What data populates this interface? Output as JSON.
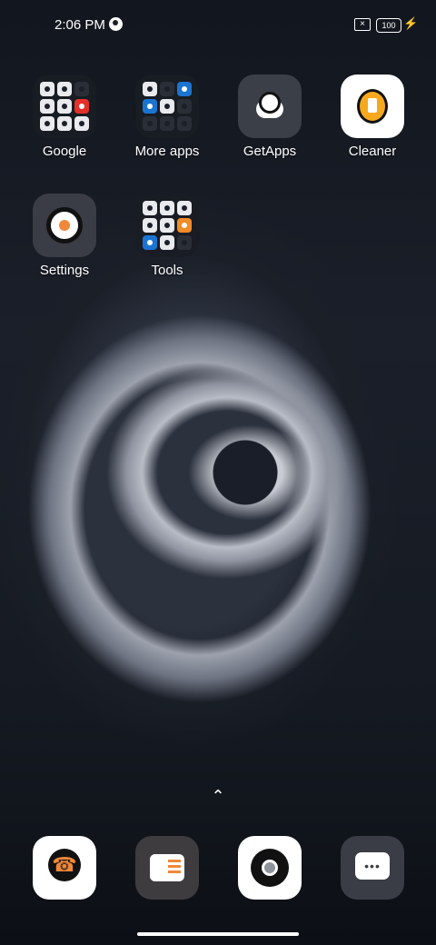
{
  "status_bar": {
    "time": "2:06 PM",
    "battery": "100",
    "charging": true
  },
  "apps": {
    "google": {
      "label": "Google"
    },
    "more_apps": {
      "label": "More apps"
    },
    "getapps": {
      "label": "GetApps"
    },
    "cleaner": {
      "label": "Cleaner"
    },
    "settings": {
      "label": "Settings"
    },
    "tools": {
      "label": "Tools"
    }
  },
  "dock": {
    "phone": {
      "label": "Phone"
    },
    "contacts": {
      "label": "Contacts"
    },
    "chrome": {
      "label": "Chrome"
    },
    "messages": {
      "label": "Messages"
    }
  },
  "colors": {
    "accent": "#f0883b",
    "cleaner_yellow": "#f6a91f"
  }
}
